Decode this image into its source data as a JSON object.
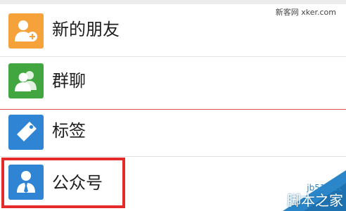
{
  "contacts_menu": {
    "items": [
      {
        "label": "新的朋友",
        "icon": "add-friend-icon",
        "icon_color": "#f6a23a"
      },
      {
        "label": "群聊",
        "icon": "group-chat-icon",
        "icon_color": "#41a63f"
      },
      {
        "label": "标签",
        "icon": "tag-icon",
        "icon_color": "#2f84d3"
      },
      {
        "label": "公众号",
        "icon": "official-account-icon",
        "icon_color": "#2f84d3"
      }
    ],
    "highlight_color": "#e42a2a"
  },
  "watermarks": {
    "top_right": "新客网 xker.com",
    "corner_site": "jb51.net",
    "corner_name": "脚本之家"
  }
}
